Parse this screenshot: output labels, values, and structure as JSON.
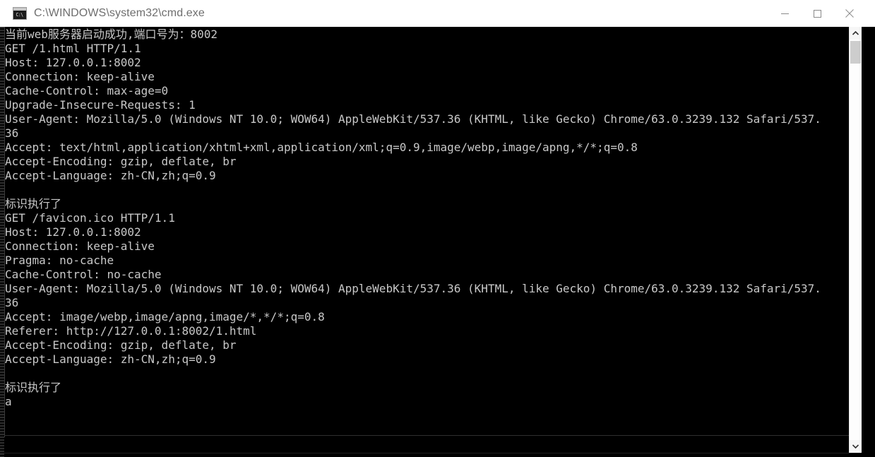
{
  "window": {
    "title": "C:\\WINDOWS\\system32\\cmd.exe",
    "icon_name": "cmd-icon",
    "icon_label": "C:\\",
    "background_color": "#000000",
    "titlebar_color": "#ffffff",
    "text_color": "#c8c8c8"
  },
  "titlebar_controls": {
    "minimize_label": "Minimize",
    "maximize_label": "Maximize",
    "close_label": "Close"
  },
  "console": {
    "lines": [
      "当前web服务器启动成功,端口号为：8002",
      "GET /1.html HTTP/1.1",
      "Host: 127.0.0.1:8002",
      "Connection: keep-alive",
      "Cache-Control: max-age=0",
      "Upgrade-Insecure-Requests: 1",
      "User-Agent: Mozilla/5.0 (Windows NT 10.0; WOW64) AppleWebKit/537.36 (KHTML, like Gecko) Chrome/63.0.3239.132 Safari/537.",
      "36",
      "Accept: text/html,application/xhtml+xml,application/xml;q=0.9,image/webp,image/apng,*/*;q=0.8",
      "Accept-Encoding: gzip, deflate, br",
      "Accept-Language: zh-CN,zh;q=0.9",
      "",
      "标识执行了",
      "GET /favicon.ico HTTP/1.1",
      "Host: 127.0.0.1:8002",
      "Connection: keep-alive",
      "Pragma: no-cache",
      "Cache-Control: no-cache",
      "User-Agent: Mozilla/5.0 (Windows NT 10.0; WOW64) AppleWebKit/537.36 (KHTML, like Gecko) Chrome/63.0.3239.132 Safari/537.",
      "36",
      "Accept: image/webp,image/apng,image/*,*/*;q=0.8",
      "Referer: http://127.0.0.1:8002/1.html",
      "Accept-Encoding: gzip, deflate, br",
      "Accept-Language: zh-CN,zh;q=0.9",
      "",
      "标识执行了",
      "a"
    ]
  },
  "scrollbar": {
    "up_arrow": "▲",
    "down_arrow": "▼"
  }
}
